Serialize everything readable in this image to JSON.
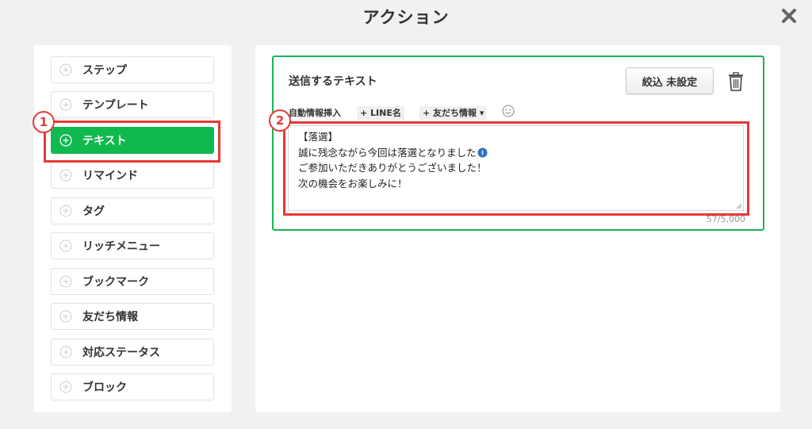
{
  "modal": {
    "title": "アクション",
    "close_icon": "close-icon"
  },
  "sidebar": {
    "items": [
      {
        "label": "ステップ",
        "active": false
      },
      {
        "label": "テンプレート",
        "active": false
      },
      {
        "label": "テキスト",
        "active": true
      },
      {
        "label": "リマインド",
        "active": false
      },
      {
        "label": "タグ",
        "active": false
      },
      {
        "label": "リッチメニュー",
        "active": false
      },
      {
        "label": "ブックマーク",
        "active": false
      },
      {
        "label": "友だち情報",
        "active": false
      },
      {
        "label": "対応ステータス",
        "active": false
      },
      {
        "label": "ブロック",
        "active": false
      }
    ]
  },
  "editor": {
    "title": "送信するテキスト",
    "filter_button": "絞込 未設定",
    "toolbar": {
      "insert_label": "自動情報挿入",
      "line_name": "+ LINE名",
      "friend_info": "+ 友だち情報 ▾"
    },
    "message_lines": [
      "【落選】",
      "誠に残念ながら今回は落選となりました",
      "ご参加いただきありがとうございました！",
      "次の機会をお楽しみに！"
    ],
    "char_count": "57/5,000"
  },
  "annotations": {
    "one": "1",
    "two": "2"
  },
  "colors": {
    "accent_green": "#10b94f",
    "annotation_red": "#e53935"
  }
}
